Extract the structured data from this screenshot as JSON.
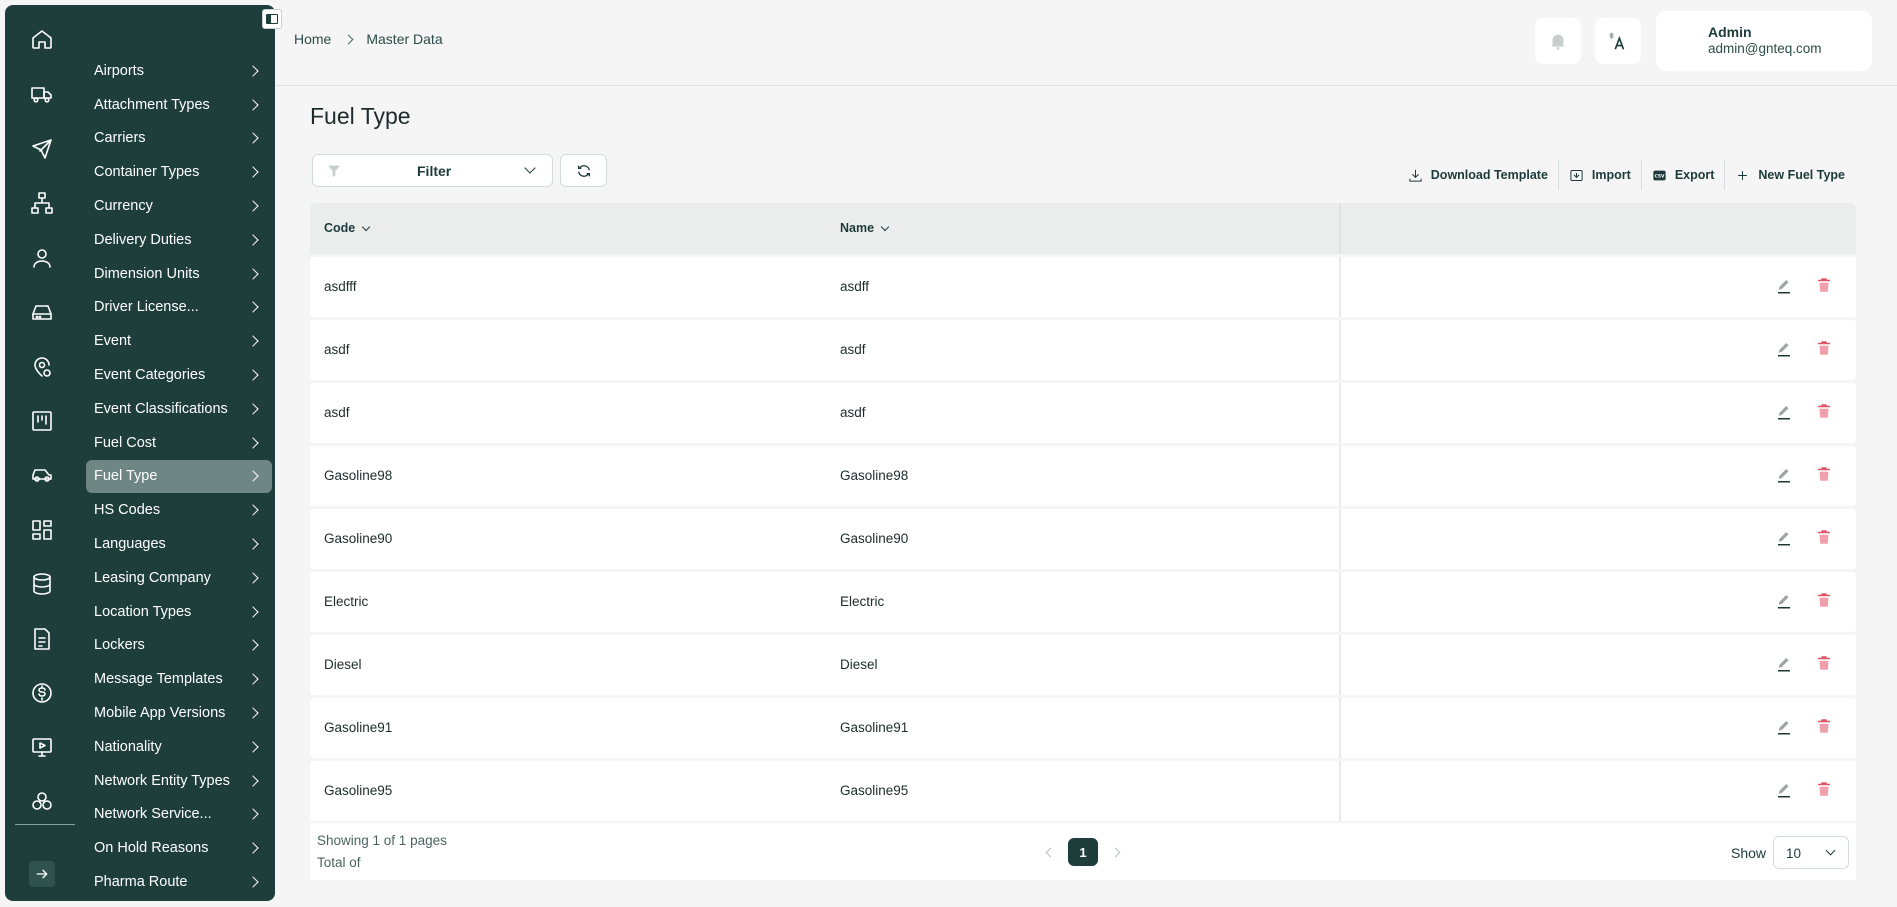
{
  "sidebar": {
    "rail_icons": [
      "home-icon",
      "truck-icon",
      "plane-icon",
      "network-icon",
      "user-icon",
      "hard-drive-icon",
      "location-settings-icon",
      "kanban-board-icon",
      "car-icon",
      "dashboard-grid-icon",
      "database-icon",
      "invoice-icon",
      "dollar-icon",
      "monitor-play-icon",
      "integration-icon"
    ],
    "submenu": [
      {
        "label": "Airports"
      },
      {
        "label": "Attachment Types"
      },
      {
        "label": "Carriers"
      },
      {
        "label": "Container Types"
      },
      {
        "label": "Currency"
      },
      {
        "label": "Delivery Duties"
      },
      {
        "label": "Dimension Units"
      },
      {
        "label": "Driver License..."
      },
      {
        "label": "Event"
      },
      {
        "label": "Event Categories"
      },
      {
        "label": "Event Classifications"
      },
      {
        "label": "Fuel Cost"
      },
      {
        "label": "Fuel Type",
        "active": true
      },
      {
        "label": "HS Codes"
      },
      {
        "label": "Languages"
      },
      {
        "label": "Leasing Company"
      },
      {
        "label": "Location Types"
      },
      {
        "label": "Lockers"
      },
      {
        "label": "Message Templates"
      },
      {
        "label": "Mobile App Versions"
      },
      {
        "label": "Nationality"
      },
      {
        "label": "Network Entity Types"
      },
      {
        "label": "Network Service..."
      },
      {
        "label": "On Hold Reasons"
      },
      {
        "label": "Pharma Route"
      }
    ]
  },
  "breadcrumb": {
    "home": "Home",
    "current": "Master Data"
  },
  "user": {
    "name": "Admin",
    "email": "admin@gnteq.com"
  },
  "page": {
    "title": "Fuel Type"
  },
  "filter": {
    "label": "Filter"
  },
  "actions": {
    "download": "Download Template",
    "import": "Import",
    "export": "Export",
    "new": "New Fuel Type"
  },
  "table": {
    "columns": {
      "code": "Code",
      "name": "Name"
    },
    "rows": [
      {
        "code": "asdfff",
        "name": "asdff"
      },
      {
        "code": "asdf",
        "name": "asdf"
      },
      {
        "code": "asdf",
        "name": "asdf"
      },
      {
        "code": "Gasoline98",
        "name": "Gasoline98"
      },
      {
        "code": "Gasoline90",
        "name": "Gasoline90"
      },
      {
        "code": "Electric",
        "name": "Electric"
      },
      {
        "code": "Diesel",
        "name": "Diesel"
      },
      {
        "code": "Gasoline91",
        "name": "Gasoline91"
      },
      {
        "code": "Gasoline95",
        "name": "Gasoline95"
      }
    ]
  },
  "pagination": {
    "showing": "Showing 1 of 1 pages",
    "total": "Total of",
    "current_page": "1",
    "show_label": "Show",
    "page_size": "10"
  },
  "colors": {
    "sidebar": "#1e3e3c",
    "active_item": "#6e8684",
    "delete": "#e0556a",
    "background": "#f4f5f4"
  }
}
